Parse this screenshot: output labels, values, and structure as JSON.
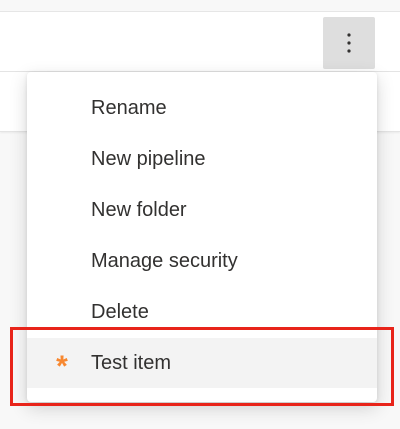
{
  "toolbar": {
    "more_actions_icon": "more-vertical-icon"
  },
  "menu": {
    "items": [
      {
        "label": "Rename"
      },
      {
        "label": "New pipeline"
      },
      {
        "label": "New folder"
      },
      {
        "label": "Manage security"
      },
      {
        "label": "Delete"
      },
      {
        "label": "Test item",
        "icon": "asterisk-icon",
        "icon_glyph": "*",
        "icon_color": "#f7872f",
        "highlighted": true
      }
    ]
  },
  "colors": {
    "accent_icon": "#f7872f",
    "annotation_outline": "#e8241a"
  }
}
